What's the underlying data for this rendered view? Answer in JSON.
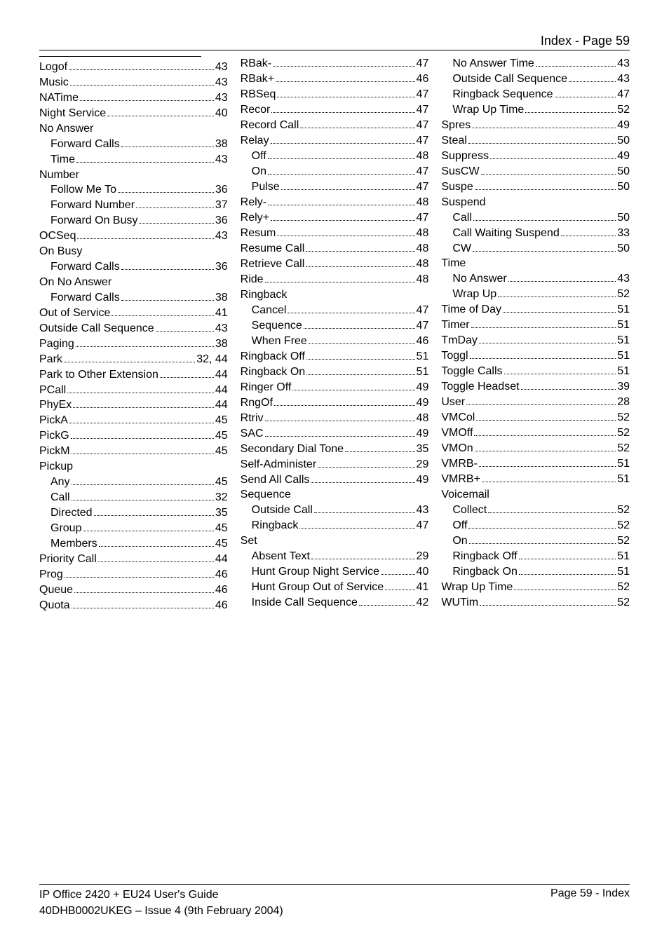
{
  "header": "Index - Page 59",
  "footer": {
    "left_line1": "IP Office 2420 + EU24 User's Guide",
    "left_line2": "40DHB0002UKEG – Issue 4 (9th February 2004)",
    "right": "Page 59 - Index"
  },
  "cols": [
    [
      {
        "label": "Logof",
        "page": "43"
      },
      {
        "label": "Music",
        "page": "43"
      },
      {
        "label": "NATime",
        "page": "43"
      },
      {
        "label": "Night Service",
        "page": "40"
      },
      {
        "heading": "No Answer"
      },
      {
        "label": "Forward Calls",
        "page": "38",
        "indent": 1
      },
      {
        "label": "Time",
        "page": "43",
        "indent": 1
      },
      {
        "heading": "Number"
      },
      {
        "label": "Follow Me To",
        "page": "36",
        "indent": 1
      },
      {
        "label": "Forward Number",
        "page": "37",
        "indent": 1
      },
      {
        "label": "Forward On Busy",
        "page": "36",
        "indent": 1
      },
      {
        "label": "OCSeq",
        "page": "43"
      },
      {
        "heading": "On Busy"
      },
      {
        "label": "Forward Calls",
        "page": "36",
        "indent": 1
      },
      {
        "heading": "On No Answer"
      },
      {
        "label": "Forward Calls",
        "page": "38",
        "indent": 1
      },
      {
        "label": "Out of Service",
        "page": "41"
      },
      {
        "label": "Outside Call Sequence",
        "page": "43"
      },
      {
        "label": "Paging",
        "page": "38"
      },
      {
        "label": "Park",
        "page": "32, 44"
      },
      {
        "label": "Park to Other Extension",
        "page": "44"
      },
      {
        "label": "PCall",
        "page": "44"
      },
      {
        "label": "PhyEx",
        "page": "44"
      },
      {
        "label": "PickA",
        "page": "45"
      },
      {
        "label": "PickG",
        "page": "45"
      },
      {
        "label": "PickM",
        "page": "45"
      },
      {
        "heading": "Pickup"
      },
      {
        "label": "Any",
        "page": "45",
        "indent": 1
      },
      {
        "label": "Call",
        "page": "32",
        "indent": 1
      },
      {
        "label": "Directed",
        "page": "35",
        "indent": 1
      },
      {
        "label": "Group",
        "page": "45",
        "indent": 1
      },
      {
        "label": "Members",
        "page": "45",
        "indent": 1
      },
      {
        "label": "Priority Call",
        "page": "44"
      },
      {
        "label": "Prog",
        "page": "46"
      },
      {
        "label": "Queue",
        "page": "46"
      },
      {
        "label": "Quota",
        "page": "46"
      }
    ],
    [
      {
        "label": "RBak-",
        "page": "47"
      },
      {
        "label": "RBak+",
        "page": "46"
      },
      {
        "label": "RBSeq",
        "page": "47"
      },
      {
        "label": "Recor",
        "page": "47"
      },
      {
        "label": "Record Call",
        "page": "47"
      },
      {
        "label": "Relay",
        "page": "47"
      },
      {
        "label": "Off",
        "page": "48",
        "indent": 1
      },
      {
        "label": "On",
        "page": "47",
        "indent": 1
      },
      {
        "label": "Pulse",
        "page": "47",
        "indent": 1
      },
      {
        "label": "Rely-",
        "page": "48"
      },
      {
        "label": "Rely+",
        "page": "47"
      },
      {
        "label": "Resum",
        "page": "48"
      },
      {
        "label": "Resume Call",
        "page": "48"
      },
      {
        "label": "Retrieve Call",
        "page": "48"
      },
      {
        "label": "Ride",
        "page": "48"
      },
      {
        "heading": "Ringback"
      },
      {
        "label": "Cancel",
        "page": "47",
        "indent": 1
      },
      {
        "label": "Sequence",
        "page": "47",
        "indent": 1
      },
      {
        "label": "When Free",
        "page": "46",
        "indent": 1
      },
      {
        "label": "Ringback Off",
        "page": "51"
      },
      {
        "label": "Ringback On",
        "page": "51"
      },
      {
        "label": "Ringer Off",
        "page": "49"
      },
      {
        "label": "RngOf",
        "page": "49"
      },
      {
        "label": "Rtriv",
        "page": "48"
      },
      {
        "label": "SAC",
        "page": "49"
      },
      {
        "label": "Secondary Dial Tone",
        "page": "35"
      },
      {
        "label": "Self-Administer",
        "page": "29"
      },
      {
        "label": "Send All Calls",
        "page": "49"
      },
      {
        "heading": "Sequence"
      },
      {
        "label": "Outside Call",
        "page": "43",
        "indent": 1
      },
      {
        "label": "Ringback",
        "page": "47",
        "indent": 1
      },
      {
        "heading": "Set"
      },
      {
        "label": "Absent Text",
        "page": "29",
        "indent": 1
      },
      {
        "label": "Hunt Group Night Service",
        "page": "40",
        "indent": 1
      },
      {
        "label": "Hunt Group Out of Service",
        "page": "41",
        "indent": 1
      },
      {
        "label": "Inside Call Sequence",
        "page": "42",
        "indent": 1
      }
    ],
    [
      {
        "label": "No Answer Time",
        "page": "43",
        "indent": 1
      },
      {
        "label": "Outside Call Sequence",
        "page": "43",
        "indent": 1
      },
      {
        "label": "Ringback Sequence",
        "page": "47",
        "indent": 1
      },
      {
        "label": "Wrap Up Time",
        "page": "52",
        "indent": 1
      },
      {
        "label": "Spres",
        "page": "49"
      },
      {
        "label": "Steal",
        "page": "50"
      },
      {
        "label": "Suppress",
        "page": "49"
      },
      {
        "label": "SusCW",
        "page": "50"
      },
      {
        "label": "Suspe",
        "page": "50"
      },
      {
        "heading": "Suspend"
      },
      {
        "label": "Call",
        "page": "50",
        "indent": 1
      },
      {
        "label": "Call Waiting Suspend",
        "page": "33",
        "indent": 1
      },
      {
        "label": "CW",
        "page": "50",
        "indent": 1
      },
      {
        "heading": "Time"
      },
      {
        "label": "No Answer",
        "page": "43",
        "indent": 1
      },
      {
        "label": "Wrap Up",
        "page": "52",
        "indent": 1
      },
      {
        "label": "Time of Day",
        "page": "51"
      },
      {
        "label": "Timer",
        "page": "51"
      },
      {
        "label": "TmDay",
        "page": "51"
      },
      {
        "label": "Toggl",
        "page": "51"
      },
      {
        "label": "Toggle Calls",
        "page": "51"
      },
      {
        "label": "Toggle Headset",
        "page": "39"
      },
      {
        "label": "User",
        "page": "28"
      },
      {
        "label": "VMCol",
        "page": "52"
      },
      {
        "label": "VMOff",
        "page": "52"
      },
      {
        "label": "VMOn",
        "page": "52"
      },
      {
        "label": "VMRB-",
        "page": "51"
      },
      {
        "label": "VMRB+",
        "page": "51"
      },
      {
        "heading": "Voicemail"
      },
      {
        "label": "Collect",
        "page": "52",
        "indent": 1
      },
      {
        "label": "Off",
        "page": "52",
        "indent": 1
      },
      {
        "label": "On",
        "page": "52",
        "indent": 1
      },
      {
        "label": "Ringback Off",
        "page": "51",
        "indent": 1
      },
      {
        "label": "Ringback On",
        "page": "51",
        "indent": 1
      },
      {
        "label": "Wrap Up Time",
        "page": "52"
      },
      {
        "label": "WUTim",
        "page": "52"
      }
    ]
  ]
}
